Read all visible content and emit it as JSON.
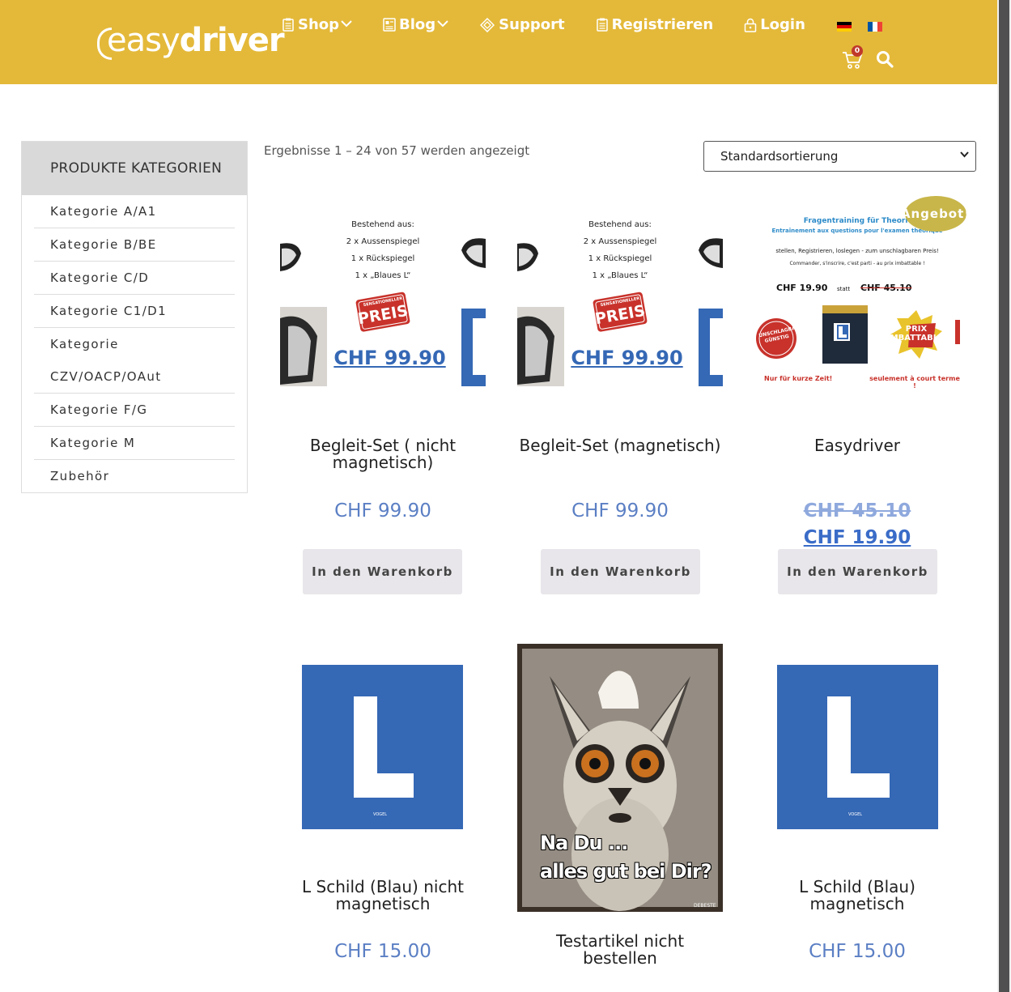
{
  "header": {
    "logo_part1": "easy",
    "logo_part2": "driver",
    "nav": [
      {
        "label": "Shop",
        "has_dropdown": true
      },
      {
        "label": "Blog",
        "has_dropdown": true
      },
      {
        "label": "Support",
        "has_dropdown": false
      },
      {
        "label": "Registrieren",
        "has_dropdown": false
      },
      {
        "label": "Login",
        "has_dropdown": false
      }
    ],
    "languages": [
      "de",
      "fr"
    ],
    "cart_count": "0",
    "colors": {
      "header_bg": "#e4b93a",
      "price": "#5b7fc4",
      "button_bg": "#e8e6ea"
    }
  },
  "sidebar": {
    "title": "PRODUKTE KATEGORIEN",
    "items": [
      "Kategorie A/A1",
      "Kategorie B/BE",
      "Kategorie C/D",
      "Kategorie C1/D1",
      "Kategorie CZV/OACP/OAut",
      "Kategorie F/G",
      "Kategorie M",
      "Zubehör"
    ]
  },
  "results_text": "Ergebnisse 1 – 24 von 57 werden angezeigt",
  "sort": {
    "selected": "Standardsortierung"
  },
  "products": [
    {
      "title": "Begleit-Set ( nicht magnetisch)",
      "price": "CHF 99.90",
      "button": "In den Warenkorb",
      "image_text": [
        "Bestehend aus:",
        "2 x Aussenspiegel",
        "1 x Rückspiegel",
        "1 x „Blaues L“",
        "SENSATIONELLER",
        "PREIS",
        "CHF 99.90"
      ]
    },
    {
      "title": "Begleit-Set (magnetisch)",
      "price": "CHF 99.90",
      "button": "In den Warenkorb",
      "image_text": [
        "Bestehend aus:",
        "2 x Aussenspiegel",
        "1 x Rückspiegel",
        "1 x „Blaues L“",
        "SENSATIONELLER",
        "PREIS",
        "CHF 99.90"
      ]
    },
    {
      "title": "Easydriver",
      "old_price": "CHF 45.10",
      "price": "CHF 19.90",
      "button": "In den Warenkorb",
      "badge": "Angebot!",
      "image_text": [
        "Fragentraining für Theorieprüfu",
        "Entraînement aux questions pour l'examen théorique",
        "stellen, Registrieren, loslegen - zum unschlagbaren Preis!",
        "Commander, s'inscrire, c'est parti - au prix imbattable !",
        "CHF 19.90",
        "statt",
        "CHF 45.10",
        "UNSCHLAGBAR GÜNSTIG",
        "PRIX IMBATTABLES",
        "Nur für kurze Zeit!",
        "seulement à court terme !"
      ]
    },
    {
      "title": "L Schild (Blau) nicht magnetisch",
      "price": "CHF 15.00",
      "image_text": [
        "VOGEL"
      ]
    },
    {
      "title": "Testartikel nicht bestellen",
      "image_text": [
        "Na Du ...",
        "alles gut bei Dir?",
        "DEBESTE"
      ]
    },
    {
      "title": "L Schild (Blau) magnetisch",
      "price": "CHF 15.00",
      "image_text": [
        "VOGEL"
      ]
    }
  ]
}
